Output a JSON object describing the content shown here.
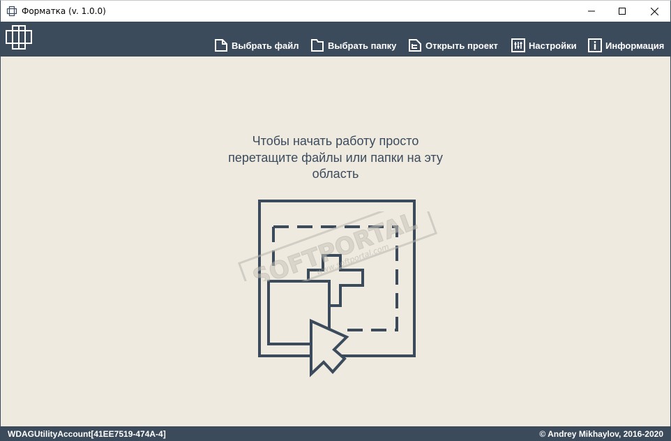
{
  "window": {
    "title": "Форматка (v. 1.0.0)",
    "app_icon": "formatka-logo-icon"
  },
  "toolbar": {
    "logo": "formatka-logo-icon",
    "items": [
      {
        "label": "Выбрать файл",
        "icon": "file-icon"
      },
      {
        "label": "Выбрать папку",
        "icon": "folder-icon"
      },
      {
        "label": "Открыть проект",
        "icon": "project-icon"
      },
      {
        "label": "Настройки",
        "icon": "sliders-icon"
      },
      {
        "label": "Информация",
        "icon": "info-icon"
      }
    ]
  },
  "main": {
    "hint_lines": [
      "Чтобы начать работу просто",
      "перетащите файлы или папки на эту",
      "область"
    ],
    "illustration": "drag-drop-icon",
    "watermark": {
      "brand": "SOFTPORTAL",
      "tm": "™",
      "url": "www.softportal.com"
    }
  },
  "statusbar": {
    "account": "WDAGUtilityAccount[41EE7519-474A-4]",
    "copyright": "© Andrey Mikhaylov, 2016-2020"
  },
  "colors": {
    "toolbar_bg": "#3c4b5c",
    "content_bg": "#eeeae0",
    "text": "#3c4b5c"
  }
}
